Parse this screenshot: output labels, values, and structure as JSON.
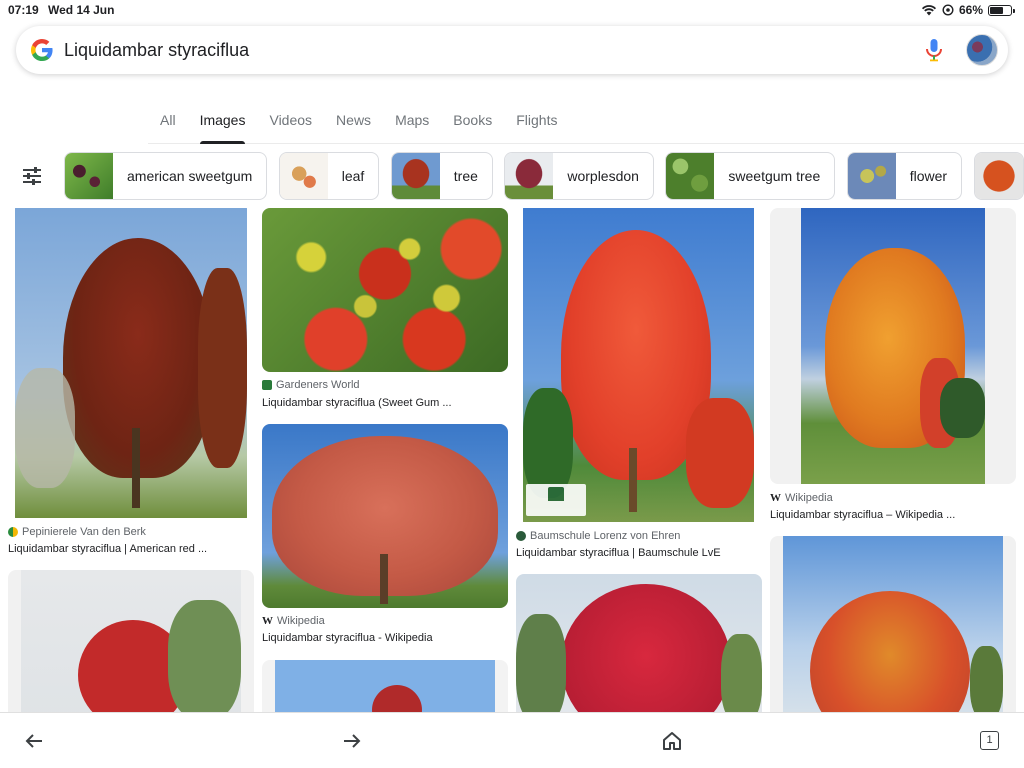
{
  "status": {
    "time": "07:19",
    "date": "Wed 14 Jun",
    "battery": "66%"
  },
  "search": {
    "query": "Liquidambar styraciflua"
  },
  "tabs": [
    {
      "label": "All"
    },
    {
      "label": "Images"
    },
    {
      "label": "Videos"
    },
    {
      "label": "News"
    },
    {
      "label": "Maps"
    },
    {
      "label": "Books"
    },
    {
      "label": "Flights"
    }
  ],
  "active_tab": "Images",
  "chips": [
    {
      "label": "american sweetgum"
    },
    {
      "label": "leaf"
    },
    {
      "label": "tree"
    },
    {
      "label": "worplesdon"
    },
    {
      "label": "sweetgum tree"
    },
    {
      "label": "flower"
    }
  ],
  "results": [
    {
      "source": "Pepinierele Van den Berk",
      "title": "Liquidambar styraciflua | American red ..."
    },
    {
      "source": "Gardeners World",
      "title": "Liquidambar styraciflua (Sweet Gum ..."
    },
    {
      "source": "Baumschule Lorenz von Ehren",
      "title": "Liquidambar styraciflua | Baumschule LvE"
    },
    {
      "source": "Wikipedia",
      "title": "Liquidambar styraciflua – Wikipedia ..."
    },
    {
      "source": "Wikipedia",
      "title": "Liquidambar styraciflua - Wikipedia"
    }
  ],
  "tab_count": "1",
  "colors": {
    "accent": "#1a73e8",
    "text": "#202124",
    "muted": "#70757a"
  }
}
